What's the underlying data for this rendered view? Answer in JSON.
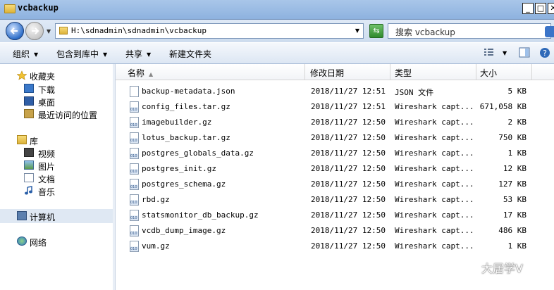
{
  "window": {
    "title": "vcbackup"
  },
  "address": {
    "path": "H:\\sdnadmin\\sdnadmin\\vcbackup",
    "search_placeholder": "搜索 vcbackup"
  },
  "toolbar": {
    "organize": "组织",
    "include_in_library": "包含到库中",
    "share": "共享",
    "new_folder": "新建文件夹"
  },
  "nav": {
    "favorites": "收藏夹",
    "downloads": "下载",
    "desktop": "桌面",
    "recent": "最近访问的位置",
    "libraries": "库",
    "videos": "视频",
    "pictures": "图片",
    "documents": "文档",
    "music": "音乐",
    "computer": "计算机",
    "network": "网络"
  },
  "columns": {
    "name": "名称",
    "date": "修改日期",
    "type": "类型",
    "size": "大小"
  },
  "files": [
    {
      "name": "backup-metadata.json",
      "date": "2018/11/27 12:51",
      "type": "JSON 文件",
      "size": "5 KB",
      "icon": "json-file-icon"
    },
    {
      "name": "config_files.tar.gz",
      "date": "2018/11/27 12:51",
      "type": "Wireshark capt...",
      "size": "671,058 KB",
      "icon": "gz-file-icon"
    },
    {
      "name": "imagebuilder.gz",
      "date": "2018/11/27 12:50",
      "type": "Wireshark capt...",
      "size": "2 KB",
      "icon": "gz-file-icon"
    },
    {
      "name": "lotus_backup.tar.gz",
      "date": "2018/11/27 12:50",
      "type": "Wireshark capt...",
      "size": "750 KB",
      "icon": "gz-file-icon"
    },
    {
      "name": "postgres_globals_data.gz",
      "date": "2018/11/27 12:50",
      "type": "Wireshark capt...",
      "size": "1 KB",
      "icon": "gz-file-icon"
    },
    {
      "name": "postgres_init.gz",
      "date": "2018/11/27 12:50",
      "type": "Wireshark capt...",
      "size": "12 KB",
      "icon": "gz-file-icon"
    },
    {
      "name": "postgres_schema.gz",
      "date": "2018/11/27 12:50",
      "type": "Wireshark capt...",
      "size": "127 KB",
      "icon": "gz-file-icon"
    },
    {
      "name": "rbd.gz",
      "date": "2018/11/27 12:50",
      "type": "Wireshark capt...",
      "size": "53 KB",
      "icon": "gz-file-icon"
    },
    {
      "name": "statsmonitor_db_backup.gz",
      "date": "2018/11/27 12:50",
      "type": "Wireshark capt...",
      "size": "17 KB",
      "icon": "gz-file-icon"
    },
    {
      "name": "vcdb_dump_image.gz",
      "date": "2018/11/27 12:50",
      "type": "Wireshark capt...",
      "size": "486 KB",
      "icon": "gz-file-icon"
    },
    {
      "name": "vum.gz",
      "date": "2018/11/27 12:50",
      "type": "Wireshark capt...",
      "size": "1 KB",
      "icon": "gz-file-icon"
    }
  ],
  "watermark": "大居学V"
}
